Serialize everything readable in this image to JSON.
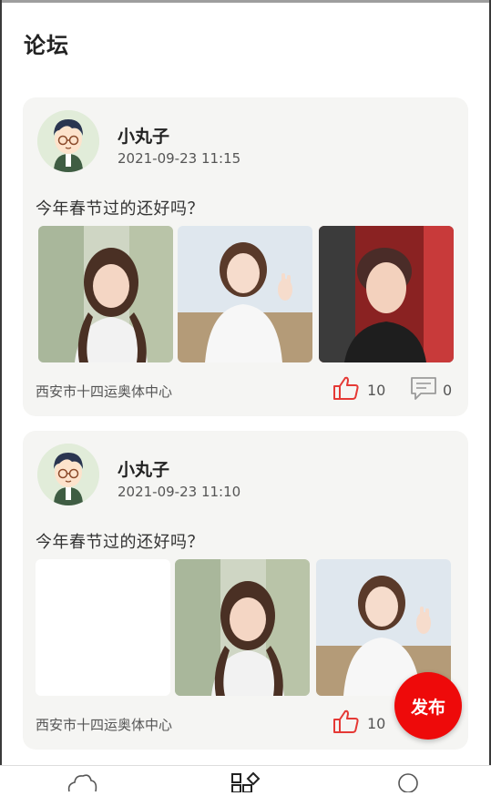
{
  "header": {
    "title": "论坛"
  },
  "posts": [
    {
      "username": "小丸子",
      "timestamp": "2021-09-23 11:15",
      "text": "今年春节过的还好吗？",
      "location": "西安市十四运奥体中心",
      "likes": "10",
      "comments": "0",
      "photos": [
        "woman-portrait-photo",
        "woman-peace-sign-photo",
        "man-selfie-photo"
      ]
    },
    {
      "username": "小丸子",
      "timestamp": "2021-09-23 11:10",
      "text": "今年春节过的还好吗？",
      "location": "西安市十四运奥体中心",
      "likes": "10",
      "photos": [
        "blank-photo",
        "woman-portrait-photo",
        "woman-peace-sign-photo"
      ]
    }
  ],
  "fab": {
    "label": "发布"
  },
  "nav": {
    "items": [
      "home-icon",
      "forum-icon",
      "profile-icon"
    ]
  },
  "colors": {
    "accent": "#ee0a0a",
    "card_bg": "#f5f5f3",
    "avatar_bg": "#e1ecd9"
  }
}
